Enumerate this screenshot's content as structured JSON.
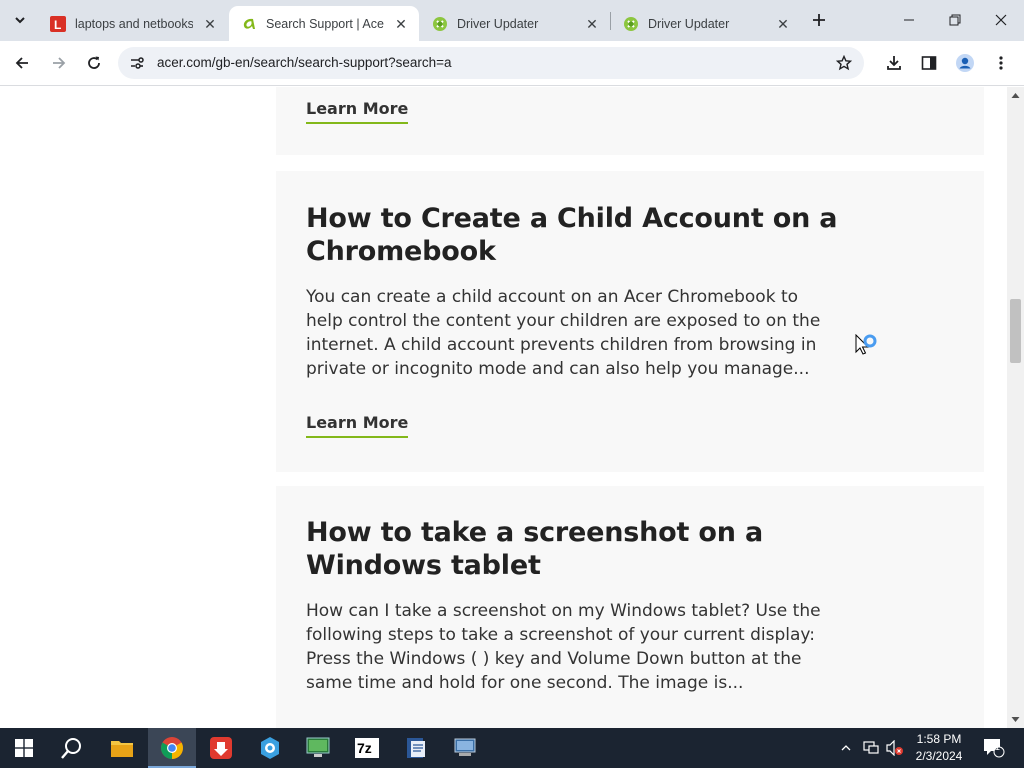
{
  "browser": {
    "tabs": [
      {
        "title": "laptops and netbooks",
        "favicon": "l-letter-icon",
        "active": false
      },
      {
        "title": "Search Support | Acer",
        "favicon": "acer-icon",
        "active": true
      },
      {
        "title": "Driver Updater",
        "favicon": "driver-updater-icon",
        "active": false
      },
      {
        "title": "Driver Updater",
        "favicon": "driver-updater-icon",
        "active": false
      }
    ],
    "url": "acer.com/gb-en/search/search-support?search=a"
  },
  "results": [
    {
      "title": "",
      "body": "",
      "link": "Learn More"
    },
    {
      "title": "How to Create a Child Account on a Chromebook",
      "body": "You can create a child account on an Acer Chromebook to help control the content your children are exposed to on the internet. A child account prevents children from browsing in private or incognito mode and can also help you manage...",
      "link": "Learn More"
    },
    {
      "title": "How to take a screenshot on a Windows tablet",
      "body": "How can I take a screenshot on my Windows tablet? Use the following steps to take a screenshot of your current display: Press the Windows ( ) key and Volume Down button at the same time and hold for one second. The image is..."
    }
  ],
  "colors": {
    "accent_green": "#83b81a",
    "card_bg": "#f8f8f8",
    "taskbar_bg": "#1b2431"
  },
  "taskbar": {
    "time": "1:58 PM",
    "date": "2/3/2024",
    "notification_count": "1"
  }
}
